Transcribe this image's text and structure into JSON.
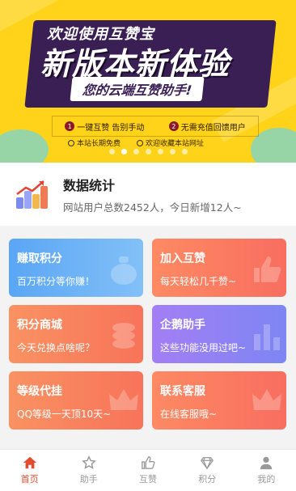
{
  "banner": {
    "line1": "欢迎使用互赞宝",
    "line2": "新版本新体验",
    "line3": "您的云端互赞助手!",
    "features": [
      {
        "num": "1",
        "text": "一键互赞 告别手动"
      },
      {
        "num": "2",
        "text": "无需充值回馈用户"
      }
    ],
    "notes": [
      "本站长期免费",
      "欢迎收藏本站网址"
    ],
    "dots_total": 7,
    "dots_active": 1
  },
  "stats": {
    "title": "数据统计",
    "desc": "网站用户总数2452人，今日新增12人~"
  },
  "cards": [
    {
      "title": "赚取积分",
      "desc": "百万积分等你赚！",
      "icon": "coin-bag-icon"
    },
    {
      "title": "加入互赞",
      "desc": "每天轻松几千赞~",
      "icon": "thumb-up-icon"
    },
    {
      "title": "积分商城",
      "desc": "今天兑换点啥呢？",
      "icon": "coins-icon"
    },
    {
      "title": "企鹅助手",
      "desc": "这些功能没用过吧~",
      "icon": "bar-chart-icon"
    },
    {
      "title": "等级代挂",
      "desc": "QQ等级一天顶10天~",
      "icon": "crown-icon"
    },
    {
      "title": "联系客服",
      "desc": "在线客服哦~",
      "icon": "crown-icon"
    }
  ],
  "nav": [
    {
      "label": "首页",
      "icon": "home-icon",
      "active": true
    },
    {
      "label": "助手",
      "icon": "star-icon",
      "active": false
    },
    {
      "label": "互赞",
      "icon": "thumb-up-icon",
      "active": false
    },
    {
      "label": "积分",
      "icon": "diamond-icon",
      "active": false
    },
    {
      "label": "我的",
      "icon": "user-icon",
      "active": false
    }
  ],
  "colors": {
    "active": "#e44c2f",
    "inactive": "#999999",
    "banner_yellow": "#ffd31a"
  }
}
